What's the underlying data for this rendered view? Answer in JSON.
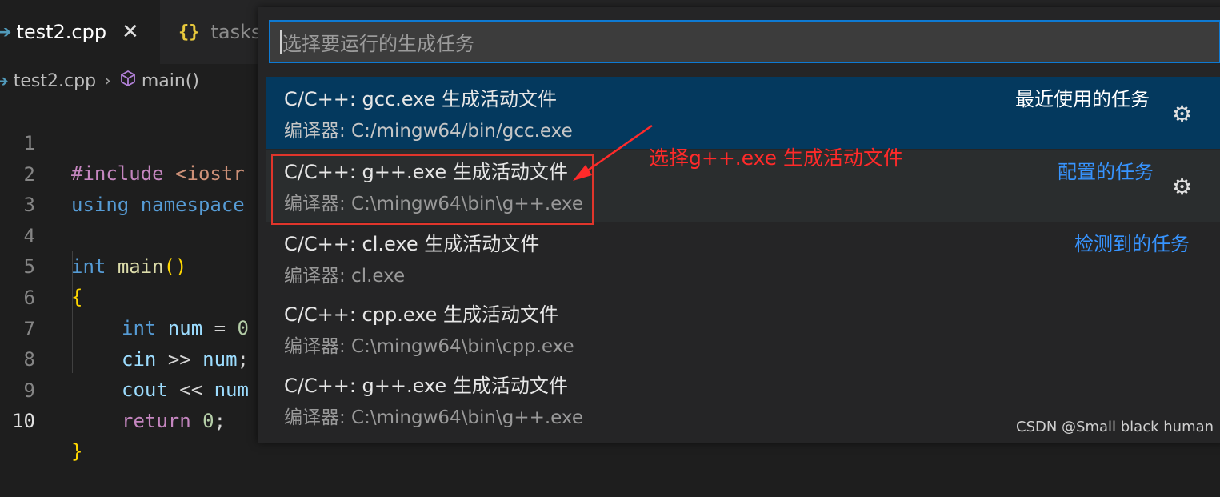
{
  "tabs": [
    {
      "label": "test2.cpp",
      "active": true,
      "icon": "cpp-file-icon"
    },
    {
      "label": "tasks.",
      "active": false,
      "icon": "json-braces-icon"
    }
  ],
  "breadcrumb": {
    "file": "test2.cpp",
    "symbol": "main()"
  },
  "editor": {
    "line_numbers": [
      "1",
      "2",
      "3",
      "4",
      "5",
      "6",
      "7",
      "8",
      "9",
      "10"
    ],
    "current_line": "10",
    "lines": {
      "l1": {
        "pp": "#include",
        "str": "<iostr"
      },
      "l2": {
        "kw1": "using",
        "kw2": "namespace"
      },
      "l4": {
        "kw": "int",
        "fn": "main",
        "paren": "()"
      },
      "l5": {
        "brace": "{"
      },
      "l6": {
        "kw": "int",
        "var": "num",
        "op": "=",
        "num": "0"
      },
      "l7": {
        "var1": "cin",
        "op": ">>",
        "var2": "num",
        "semi": ";"
      },
      "l8": {
        "var1": "cout",
        "op": "<<",
        "var2": "num"
      },
      "l9": {
        "ctrl": "return",
        "num": "0",
        "semi": ";"
      },
      "l10": {
        "brace": "}"
      }
    }
  },
  "quick_pick": {
    "placeholder": "选择要运行的生成任务",
    "items": [
      {
        "title": "C/C++: gcc.exe 生成活动文件",
        "detail": "编译器: C:/mingw64/bin/gcc.exe",
        "group": "最近使用的任务",
        "selected": true,
        "gear": true
      },
      {
        "title": "C/C++: g++.exe 生成活动文件",
        "detail": "编译器: C:\\mingw64\\bin\\g++.exe",
        "group": "配置的任务",
        "selected": false,
        "gear": true
      },
      {
        "title": "C/C++: cl.exe 生成活动文件",
        "detail": "编译器: cl.exe",
        "group": "检测到的任务",
        "selected": false,
        "gear": false
      },
      {
        "title": "C/C++: cpp.exe 生成活动文件",
        "detail": "编译器: C:\\mingw64\\bin\\cpp.exe",
        "group": "",
        "selected": false,
        "gear": false
      },
      {
        "title": "C/C++: g++.exe 生成活动文件",
        "detail": "编译器: C:\\mingw64\\bin\\g++.exe",
        "group": "",
        "selected": false,
        "gear": false
      }
    ]
  },
  "annotation": {
    "text": "选择g++.exe 生成活动文件",
    "color": "#ff2a2a"
  },
  "watermark": "CSDN @Small black human",
  "colors": {
    "accent": "#0e7ad3",
    "selected_bg": "#04395e",
    "group_label_blue": "#3794ff"
  }
}
